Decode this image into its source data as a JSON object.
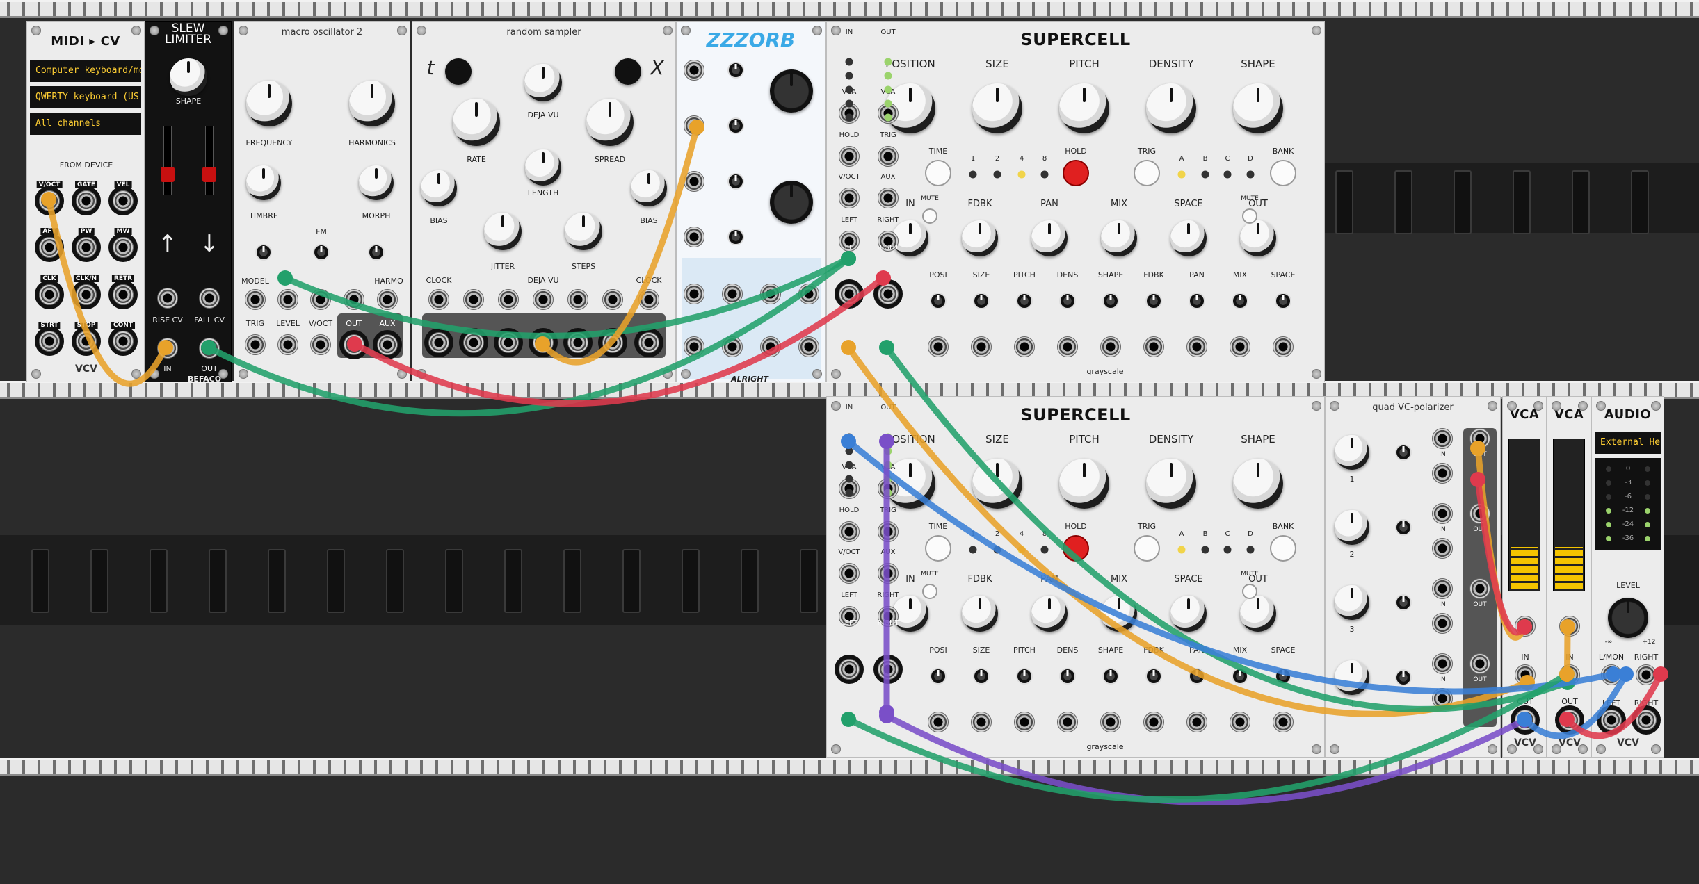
{
  "rails": {
    "labels": []
  },
  "midi_cv": {
    "title": "MIDI ▸ CV",
    "driver": "Computer keyboard/mo",
    "device": "QWERTY keyboard (US",
    "channel": "All channels",
    "section": "FROM DEVICE",
    "jacks": [
      "V/OCT",
      "GATE",
      "VEL",
      "AFT",
      "PW",
      "MW",
      "CLK",
      "CLK/N",
      "RETR",
      "STRT",
      "STOP",
      "CONT"
    ],
    "brand": "VCV"
  },
  "slew": {
    "title": "SLEW\nLIMITER",
    "knob": "SHAPE",
    "rise": "RISE CV",
    "fall": "FALL CV",
    "in": "IN",
    "out": "OUT",
    "brand": "BEFACO"
  },
  "macro": {
    "title": "macro oscillator 2",
    "freq": "FREQUENCY",
    "harm": "HARMONICS",
    "timbre": "TIMBRE",
    "morph": "MORPH",
    "fm": "FM",
    "model": "MODEL",
    "harmo": "HARMO",
    "jacks": [
      "TRIG",
      "LEVEL",
      "V/OCT",
      "OUT",
      "AUX"
    ]
  },
  "sampler": {
    "title": "random sampler",
    "t": "t",
    "x": "X",
    "rate": "RATE",
    "dejavu": "DEJA VU",
    "spread": "SPREAD",
    "bias": "BIAS",
    "length": "LENGTH",
    "jitter": "JITTER",
    "steps": "STEPS",
    "clock": "CLOCK",
    "dejavu2": "DEJA VU",
    "bias2": "BIAS",
    "clock2": "CLOCK"
  },
  "zzzorb": {
    "title": "ZZZORB",
    "brand": "ALRIGHT"
  },
  "supercell_1": {
    "title": "SUPERCELL",
    "knobs": [
      "POSITION",
      "SIZE",
      "PITCH",
      "DENSITY",
      "SHAPE"
    ],
    "time": "TIME",
    "nums": [
      "1",
      "2",
      "4",
      "8"
    ],
    "hold": "HOLD",
    "trig": "TRIG",
    "letters": [
      "A",
      "B",
      "C",
      "D"
    ],
    "bank": "BANK",
    "row3": [
      "IN",
      "FDBK",
      "PAN",
      "MIX",
      "SPACE",
      "OUT"
    ],
    "mute": "MUTE",
    "cv": [
      "POSI",
      "SIZE",
      "PITCH",
      "DENS",
      "SHAPE",
      "FDBK",
      "PAN",
      "MIX",
      "SPACE"
    ],
    "brand": "grayscale",
    "io": [
      "IN",
      "OUT",
      "VCA",
      "VCA",
      "HOLD",
      "TRIG",
      "V/OCT",
      "AUX",
      "LEFT",
      "RIGHT",
      "LEFT",
      "RIGHT"
    ]
  },
  "supercell_2": {
    "title": "SUPERCELL",
    "brand": "grayscale"
  },
  "polarizer": {
    "title": "quad VC-polarizer",
    "in": "IN",
    "out": "OUT",
    "nums": [
      "1",
      "2",
      "3",
      "4"
    ]
  },
  "vca1": {
    "title": "VCA",
    "in": "IN",
    "out": "OUT",
    "brand": "VCV"
  },
  "vca2": {
    "title": "VCA",
    "in": "IN",
    "out": "OUT",
    "brand": "VCV"
  },
  "audio": {
    "title": "AUDIO",
    "device": "External Hea",
    "scale": [
      "0",
      "-3",
      "-6",
      "-12",
      "-24",
      "-36"
    ],
    "level": "LEVEL",
    "min": "-∞",
    "max": "+12",
    "lmon": "L/MON",
    "right": "RIGHT",
    "left": "LEFT",
    "right2": "RIGHT",
    "brand": "VCV"
  },
  "cable_colors": {
    "yellow": "#e8a22a",
    "green": "#22a06b",
    "red": "#df3a4d",
    "purple": "#7a4fc8",
    "blue": "#3a7fd6",
    "teal": "#2bbf8a"
  }
}
